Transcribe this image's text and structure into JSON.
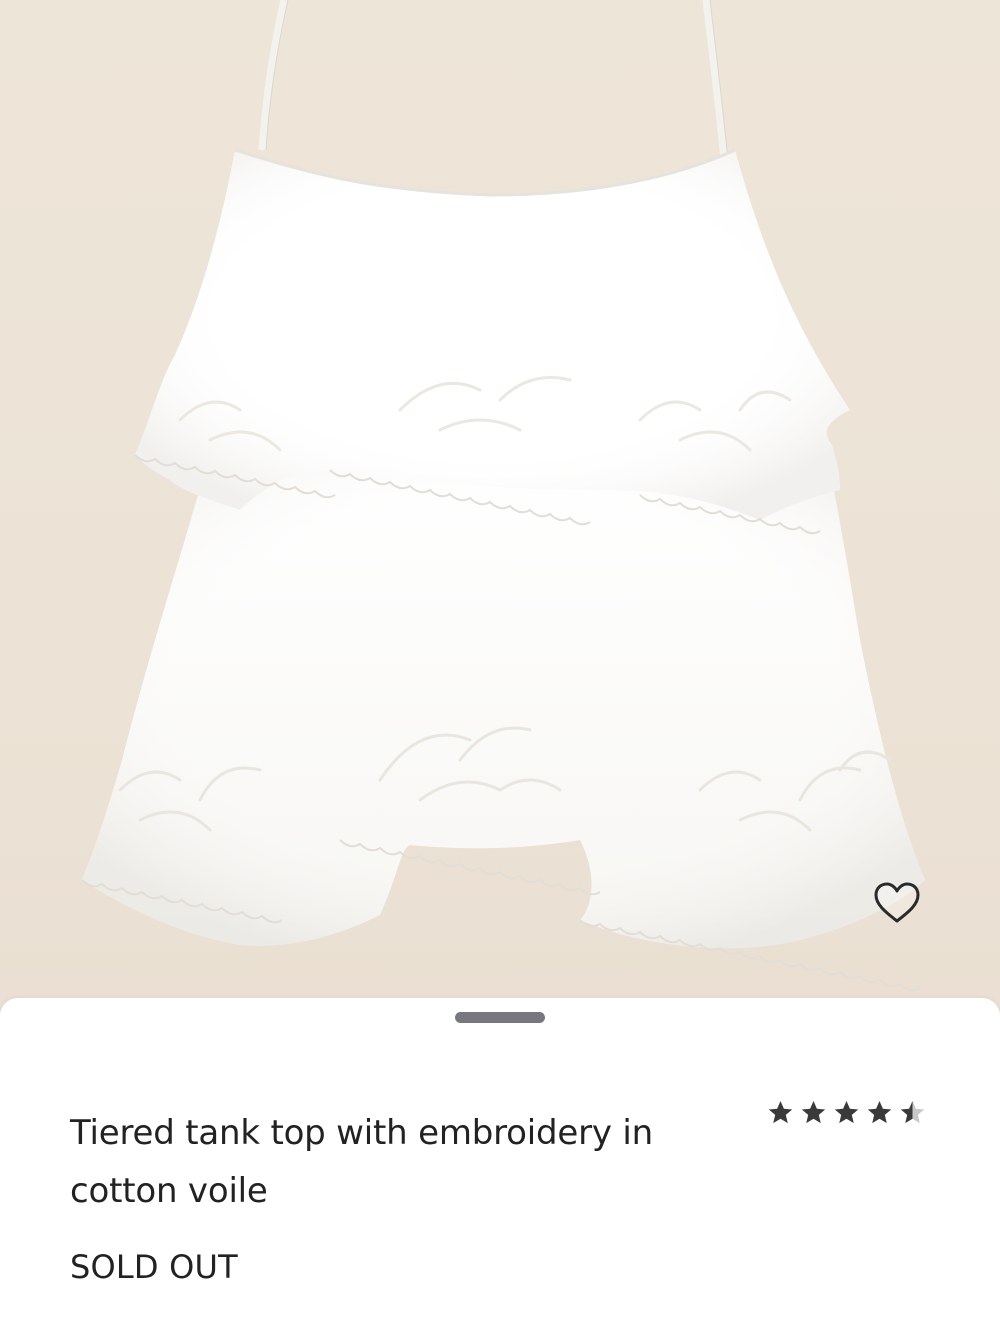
{
  "product": {
    "image_alt": "White tiered tank top with embroidery",
    "title": "Tiered tank top with embroidery in cotton voile",
    "status": "SOLD OUT",
    "rating": 4.5,
    "rating_max": 5
  },
  "icons": {
    "wishlist": "heart-outline-icon",
    "rating": "star-icon"
  },
  "colors": {
    "backdrop": "#ede4d8",
    "sheet": "#ffffff",
    "star": "#3a3a3a",
    "star_empty": "#c8c8c8",
    "handle": "#777780",
    "text": "#222222"
  }
}
